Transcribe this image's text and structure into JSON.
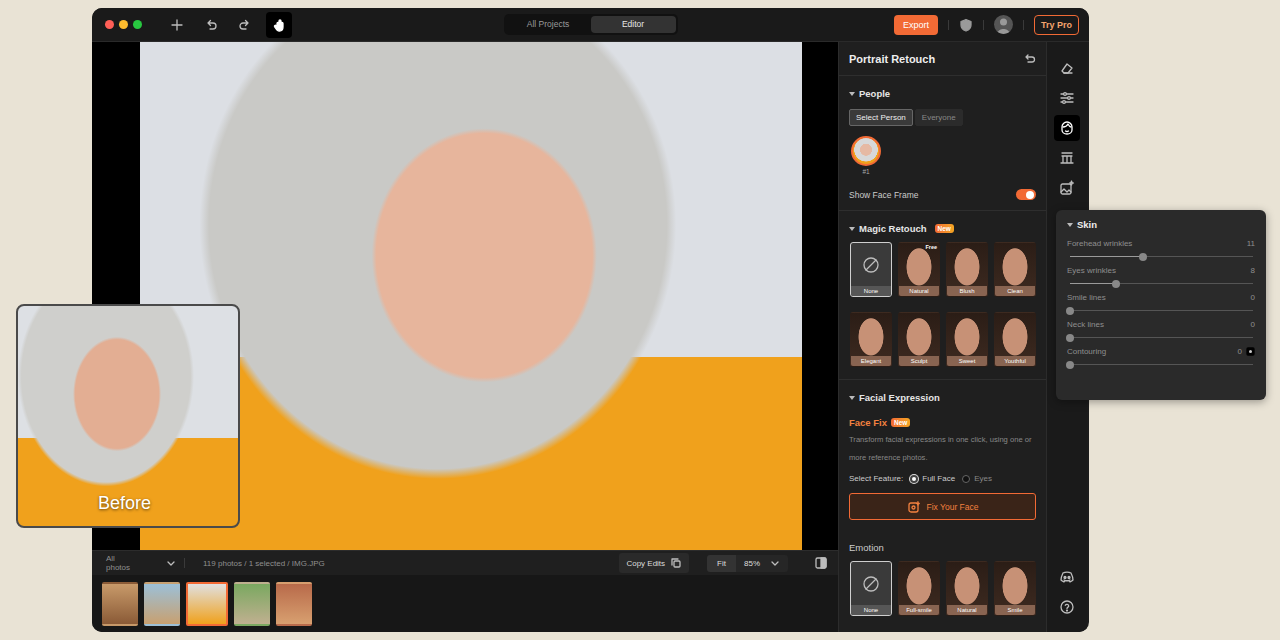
{
  "toolbar": {
    "tools": [
      {
        "selected": false
      },
      {
        "selected": false
      },
      {
        "selected": false
      },
      {
        "selected": true
      }
    ],
    "tabs": [
      {
        "label": "All Projects",
        "selected": false
      },
      {
        "label": "Editor",
        "selected": true
      }
    ],
    "export": "Export",
    "try_pro": "Try Pro"
  },
  "canvas": {
    "before_label": "Before"
  },
  "bottom_bar": {
    "filter": "All photos",
    "info": "119 photos / 1 selected / IMG.JPG",
    "copy_edits": "Copy Edits",
    "fit": "Fit",
    "zoom": "85%"
  },
  "thumbnails": [
    {
      "selected": false
    },
    {
      "selected": false
    },
    {
      "selected": true
    },
    {
      "selected": false
    },
    {
      "selected": false
    }
  ],
  "panel": {
    "title": "Portrait Retouch",
    "people": {
      "header": "People",
      "segments": [
        {
          "label": "Select Person",
          "selected": true
        },
        {
          "label": "Everyone",
          "selected": false
        }
      ],
      "persons": [
        {
          "label": "#1",
          "selected": true
        }
      ],
      "face_frame": {
        "label": "Show Face Frame",
        "on": true
      }
    },
    "magic_retouch": {
      "header": "Magic Retouch",
      "badge": "New",
      "presets": [
        {
          "label": "None",
          "kind": "none",
          "selected": true
        },
        {
          "label": "Natural",
          "kind": "face",
          "selected": false,
          "badge": "Free"
        },
        {
          "label": "Blush",
          "kind": "face",
          "selected": false
        },
        {
          "label": "Clean",
          "kind": "face",
          "selected": false
        },
        {
          "label": "Elegant",
          "kind": "face",
          "selected": false
        },
        {
          "label": "Sculpt",
          "kind": "face",
          "selected": false
        },
        {
          "label": "Sweet",
          "kind": "face",
          "selected": false
        },
        {
          "label": "Youthful",
          "kind": "face",
          "selected": false
        }
      ]
    },
    "facial_expression": {
      "header": "Facial Expression",
      "title": "Face Fix",
      "badge": "New",
      "description": "Transform facial expressions in one click, using one or more reference photos.",
      "feature_label": "Select Feature:",
      "features": [
        {
          "label": "Full Face",
          "selected": true
        },
        {
          "label": "Eyes",
          "selected": false
        }
      ],
      "button": "Fix Your Face"
    },
    "emotion": {
      "header": "Emotion",
      "presets": [
        {
          "label": "None",
          "kind": "none",
          "selected": true
        },
        {
          "label": "Full-smile",
          "kind": "face",
          "selected": false
        },
        {
          "label": "Natural",
          "kind": "face",
          "selected": false
        },
        {
          "label": "Smile",
          "kind": "face",
          "selected": false
        }
      ]
    }
  },
  "tool_rail": {
    "tools": [
      {
        "selected": false
      },
      {
        "selected": false
      },
      {
        "selected": true
      },
      {
        "selected": false
      },
      {
        "selected": false
      }
    ]
  },
  "skin_panel": {
    "title": "Skin",
    "sliders": [
      {
        "label": "Forehead wrinkles",
        "reading": "11",
        "level": 0.4
      },
      {
        "label": "Eyes wrinkles",
        "reading": "8",
        "level": 0.25
      },
      {
        "label": "Smile lines",
        "reading": "0",
        "level": 0
      },
      {
        "label": "Neck lines",
        "reading": "0",
        "level": 0
      },
      {
        "label": "Contouring",
        "reading": "0",
        "level": 0
      }
    ]
  }
}
